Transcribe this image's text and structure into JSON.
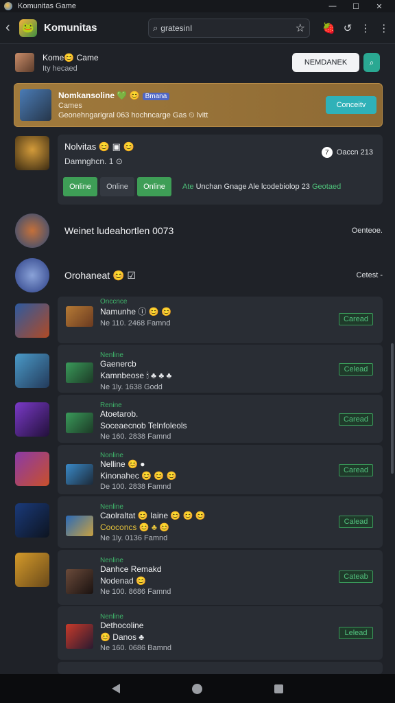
{
  "window": {
    "title": "Komunitas Game"
  },
  "header": {
    "back": "‹",
    "logo": "🐸",
    "title": "Komunitas",
    "search_value": "gratesinI",
    "search_icon": "⌕",
    "star": "☆",
    "icons": [
      "🍓",
      "↺",
      "⋮",
      "⋮"
    ]
  },
  "user": {
    "name": "Kome😊 Came",
    "status": "Ity hecaed",
    "button": "NEMDANEK",
    "button2": "⌕"
  },
  "featured": {
    "title": "Nomkansoline 💚 😊",
    "badge": "Bmana",
    "sub": "Cames",
    "meta": "Geonehngarigral 063 hochncarge Gas ⏲ lvitt",
    "button": "Conceitv"
  },
  "notice": {
    "title": "Nolvitas 😊 ▣ 😊",
    "sub": "Damnghcn. 1 ⊙",
    "date_icon": "7",
    "date": "Oaccn 213",
    "buttons": [
      "Online",
      "Online",
      "Online"
    ],
    "meta_accent": "Ate",
    "meta": "Unchan Gnage Ale lcodebiolop 23",
    "meta_end": "Geotaed"
  },
  "sections": [
    {
      "title": "Weinet ludeahortlen 0073",
      "right": "Oenteoe."
    },
    {
      "title": "Orohaneat 😊 ☑",
      "right": "Cetest -"
    }
  ],
  "items": [
    {
      "tag": "Onccnce",
      "name": "Namunhe ⓘ 😊 😊",
      "sub": "",
      "meta": "Ne 110. 2468 Famnd",
      "button": "Caread"
    },
    {
      "tag": "Nenline",
      "name": "Gaenercb",
      "sub": "Kamnbeose 🕯 ♣ ♣ ♣",
      "meta": "Ne 1ly. 1638 Godd",
      "button": "Celead"
    },
    {
      "tag": "Renine",
      "name": "Atoetarob.",
      "sub": "Soceaecnob Telnfoleols",
      "meta": "Ne 160. 2838 Famnd",
      "button": "Caread"
    },
    {
      "tag": "Nonline",
      "name": "Nelline 😊 ●",
      "sub": "Kinonahec 😊 😊 😊",
      "meta": "De 100. 2838 Famnd",
      "button": "Caread"
    },
    {
      "tag": "Nenline",
      "name": "Caolraltat 😊 Iaine 😊 😊 😊",
      "sub": "Cooconcs 😊 ♣ 😊",
      "meta": "Ne 1ly. 0136 Famnd",
      "button": "Calead"
    },
    {
      "tag": "Nenline",
      "name": "Danhce Remakd",
      "sub": "Nodenad 😊",
      "meta": "Ne 100. 8686 Famnd",
      "button": "Cateab"
    },
    {
      "tag": "Nenline",
      "name": "Dethocoline",
      "sub": "😊 Danos ♣",
      "meta": "Ne 160. 0686 Bamnd",
      "button": "Lelead"
    }
  ],
  "colors": {
    "accent": "#3fb46a",
    "featured": "#a07a3c",
    "card": "#292d34"
  }
}
